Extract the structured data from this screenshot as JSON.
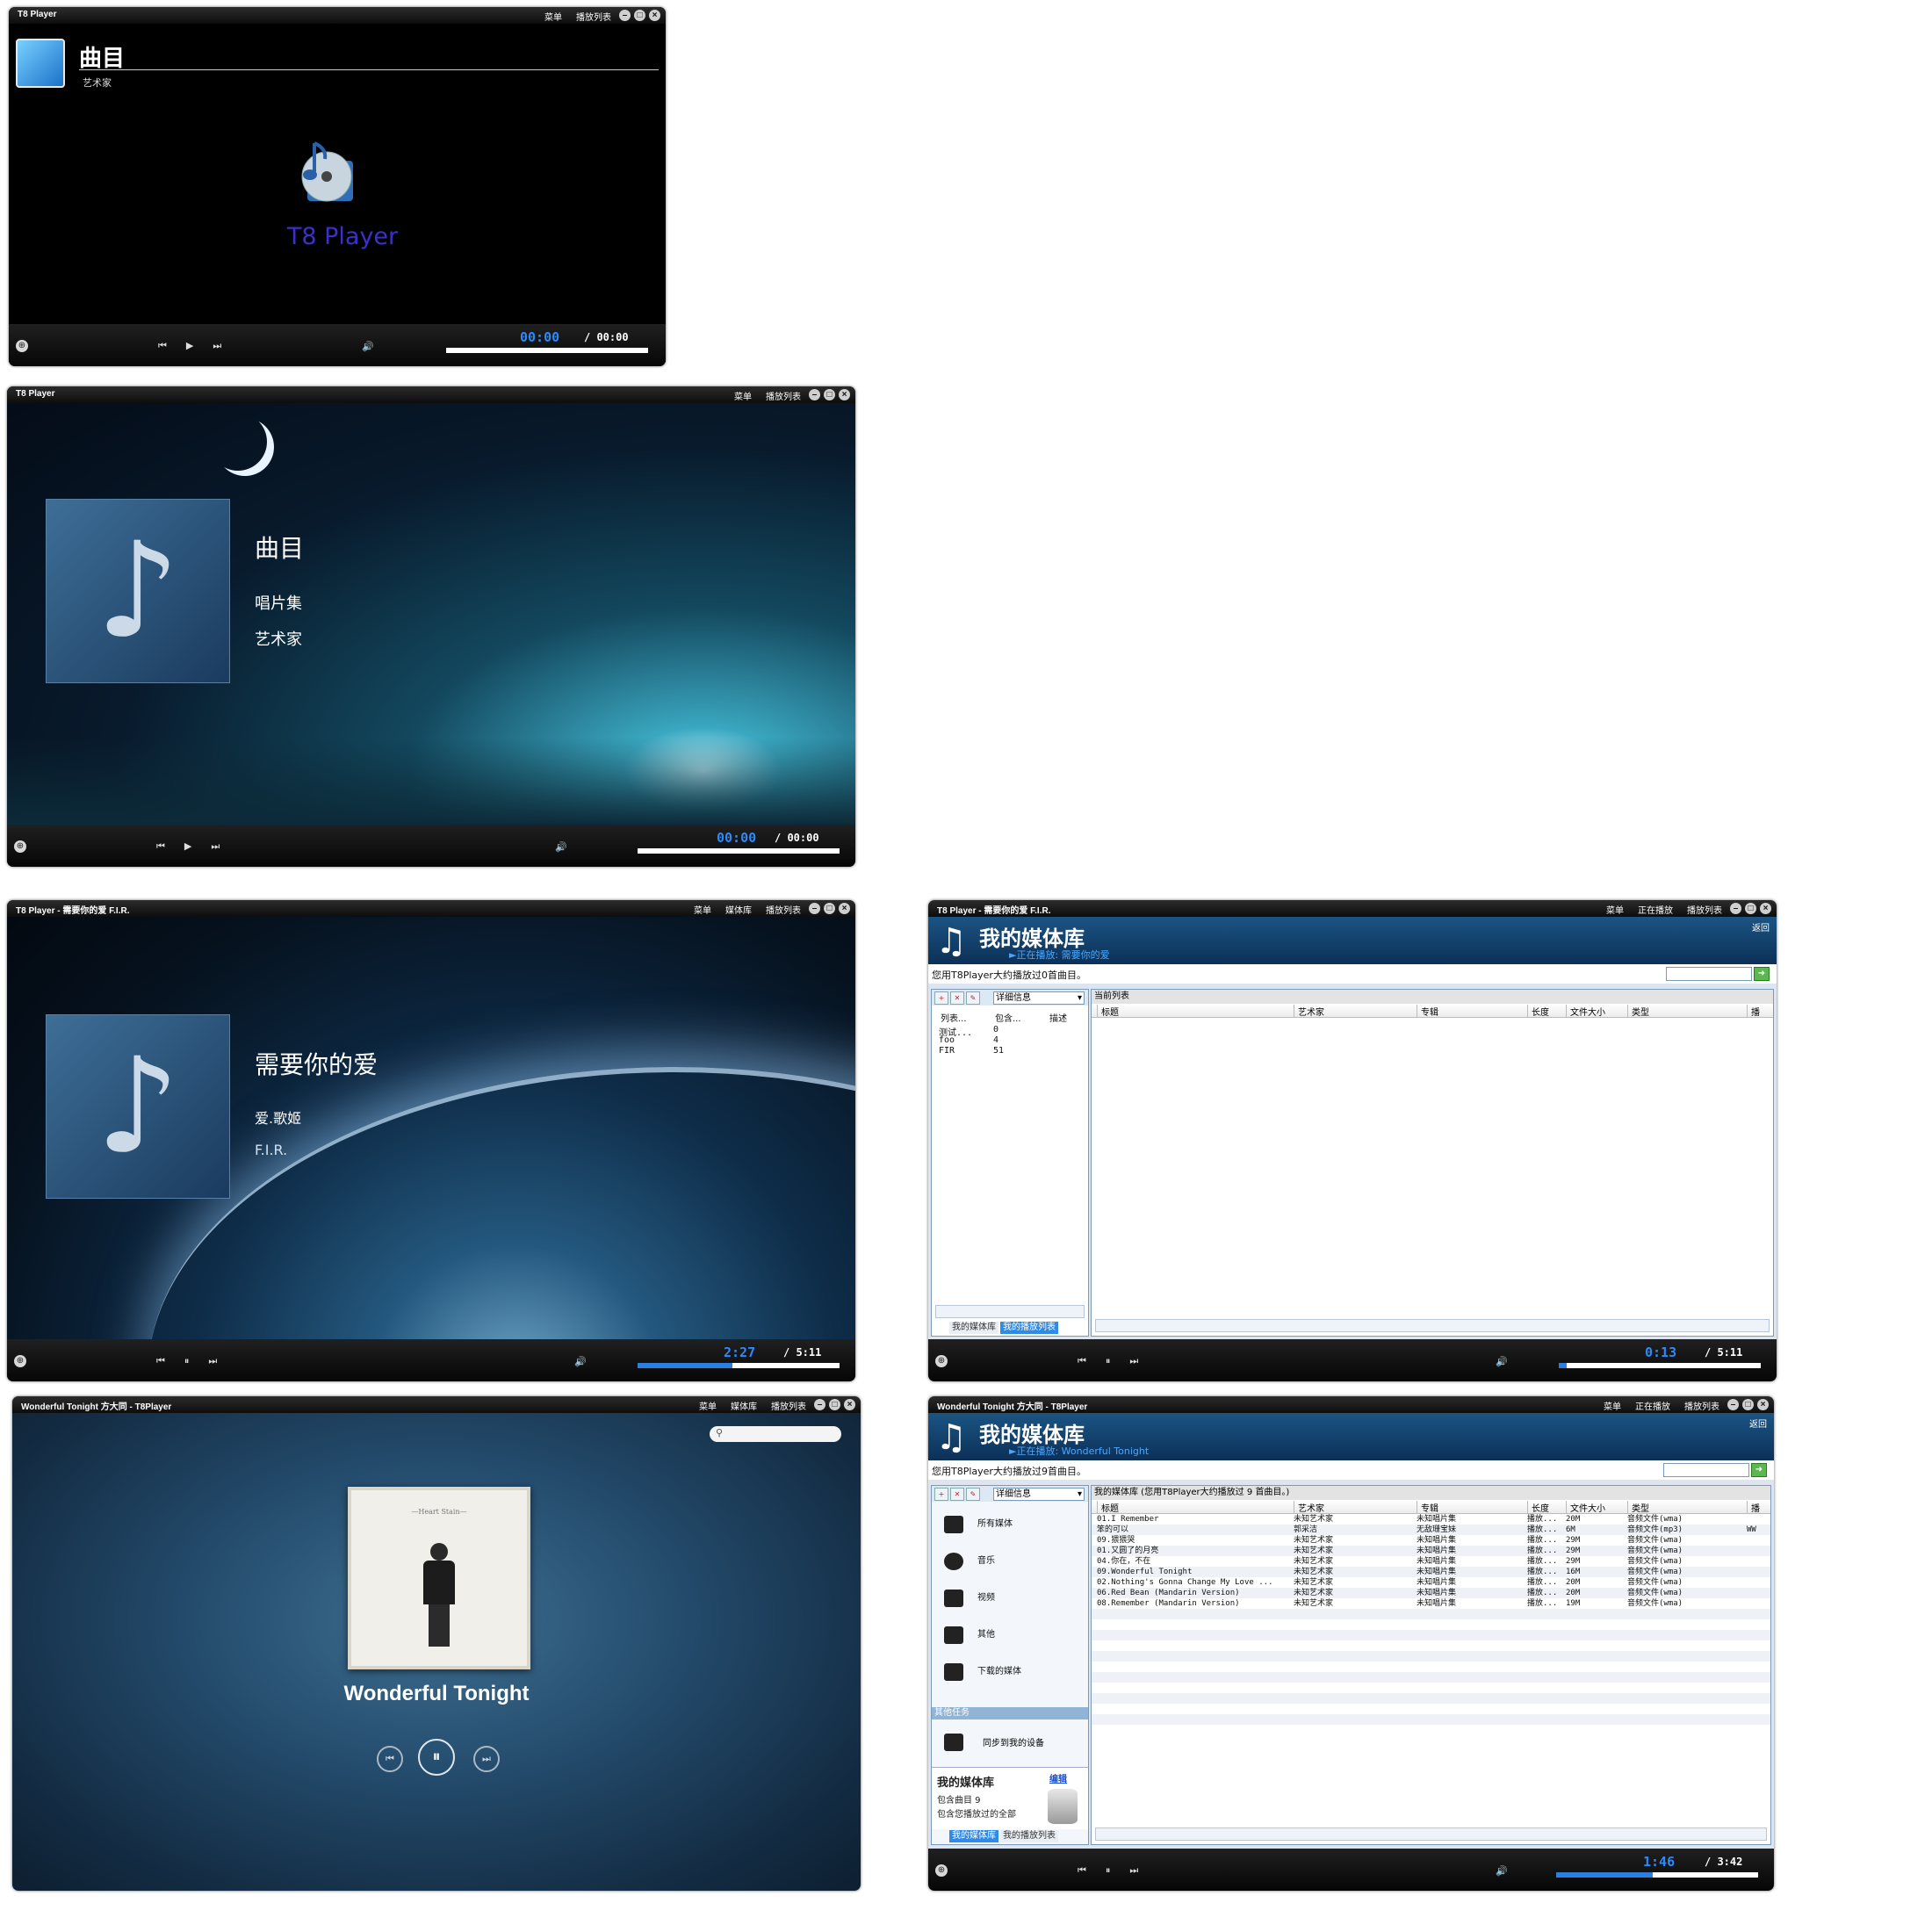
{
  "window1": {
    "title": "T8 Player",
    "menu": [
      "菜单",
      "播放列表"
    ],
    "track_title": "曲目",
    "artist": "艺术家",
    "logo_text": "T8 Player",
    "time_current": "00:00",
    "time_total": "/ 00:00",
    "progress": 0
  },
  "window2": {
    "title": "T8 Player",
    "menu": [
      "菜单",
      "播放列表"
    ],
    "track_title": "曲目",
    "album": "唱片集",
    "artist": "艺术家",
    "time_current": "00:00",
    "time_total": "/ 00:00",
    "progress": 0
  },
  "window3": {
    "title": "T8 Player - 需要你的爱 F.I.R.",
    "menu": [
      "菜单",
      "媒体库",
      "播放列表"
    ],
    "track_title": "需要你的爱",
    "album": "爱.歌姬",
    "artist": "F.I.R.",
    "time_current": "2:27",
    "time_total": "/ 5:11",
    "progress": 0.47
  },
  "window4": {
    "title": "T8 Player - 需要你的爱 F.I.R.",
    "menu": [
      "菜单",
      "正在播放",
      "播放列表"
    ],
    "back": "返回",
    "lib_title": "我的媒体库",
    "now_playing": "►正在播放: 需要你的爱",
    "info": "您用T8Player大约播放过0首曲目。",
    "view_select": "详细信息",
    "left_cols": [
      "列表...",
      "包含...",
      "描述"
    ],
    "playlists": [
      {
        "name": "测试...",
        "count": "0"
      },
      {
        "name": "foo",
        "count": "4"
      },
      {
        "name": "FIR",
        "count": "51"
      }
    ],
    "right_header": "当前列表",
    "cols": [
      "标题",
      "艺术家",
      "专辑",
      "长度",
      "文件大小",
      "类型",
      "播"
    ],
    "tabs": [
      "我的媒体库",
      "我的播放列表"
    ],
    "time_current": "0:13",
    "time_total": "/ 5:11",
    "progress": 0.04
  },
  "window5": {
    "title": "Wonderful Tonight 方大同 - T8Player",
    "menu": [
      "菜单",
      "媒体库",
      "播放列表"
    ],
    "song": "Wonderful Tonight",
    "cover_text": "—Heart Stain—"
  },
  "window6": {
    "title": "Wonderful Tonight 方大同 - T8Player",
    "menu": [
      "菜单",
      "正在播放",
      "播放列表"
    ],
    "back": "返回",
    "lib_title": "我的媒体库",
    "now_playing": "►正在播放: Wonderful Tonight",
    "info": "您用T8Player大约播放过9首曲目。",
    "view_select": "详细信息",
    "side_items": [
      "所有媒体",
      "音乐",
      "视频",
      "其他",
      "下载的媒体"
    ],
    "other_tasks": "其他任务",
    "sync": "同步到我的设备",
    "summary_title": "我的媒体库",
    "summary_edit": "编辑",
    "summary_line1": "包含曲目 9",
    "summary_line2": "包含您播放过的全部",
    "right_header": "我的媒体库 (您用T8Player大约播放过 9 首曲目。)",
    "cols": [
      "标题",
      "艺术家",
      "专辑",
      "长度",
      "文件大小",
      "类型",
      "播"
    ],
    "rows": [
      [
        "01.I Remember",
        "未知艺术家",
        "未知唱片集",
        "播放...",
        "20M",
        "音频文件(wma)",
        ""
      ],
      [
        "笨的可以",
        "郭采洁",
        "无敌珊宝妹",
        "播放...",
        "6M",
        "音频文件(mp3)",
        "WW"
      ],
      [
        "09.猥猥哭",
        "未知艺术家",
        "未知唱片集",
        "播放...",
        "29M",
        "音频文件(wma)",
        ""
      ],
      [
        "01.又圆了的月亮",
        "未知艺术家",
        "未知唱片集",
        "播放...",
        "29M",
        "音频文件(wma)",
        ""
      ],
      [
        "04.你在，不在",
        "未知艺术家",
        "未知唱片集",
        "播放...",
        "29M",
        "音频文件(wma)",
        ""
      ],
      [
        "09.Wonderful Tonight",
        "未知艺术家",
        "未知唱片集",
        "播放...",
        "16M",
        "音频文件(wma)",
        ""
      ],
      [
        "02.Nothing's Gonna Change My Love ...",
        "未知艺术家",
        "未知唱片集",
        "播放...",
        "20M",
        "音频文件(wma)",
        ""
      ],
      [
        "06.Red Bean (Mandarin Version)",
        "未知艺术家",
        "未知唱片集",
        "播放...",
        "20M",
        "音频文件(wma)",
        ""
      ],
      [
        "08.Remember (Mandarin Version)",
        "未知艺术家",
        "未知唱片集",
        "播放...",
        "19M",
        "音频文件(wma)",
        ""
      ]
    ],
    "tabs": [
      "我的媒体库",
      "我的播放列表"
    ],
    "time_current": "1:46",
    "time_total": "/ 3:42",
    "progress": 0.48
  }
}
